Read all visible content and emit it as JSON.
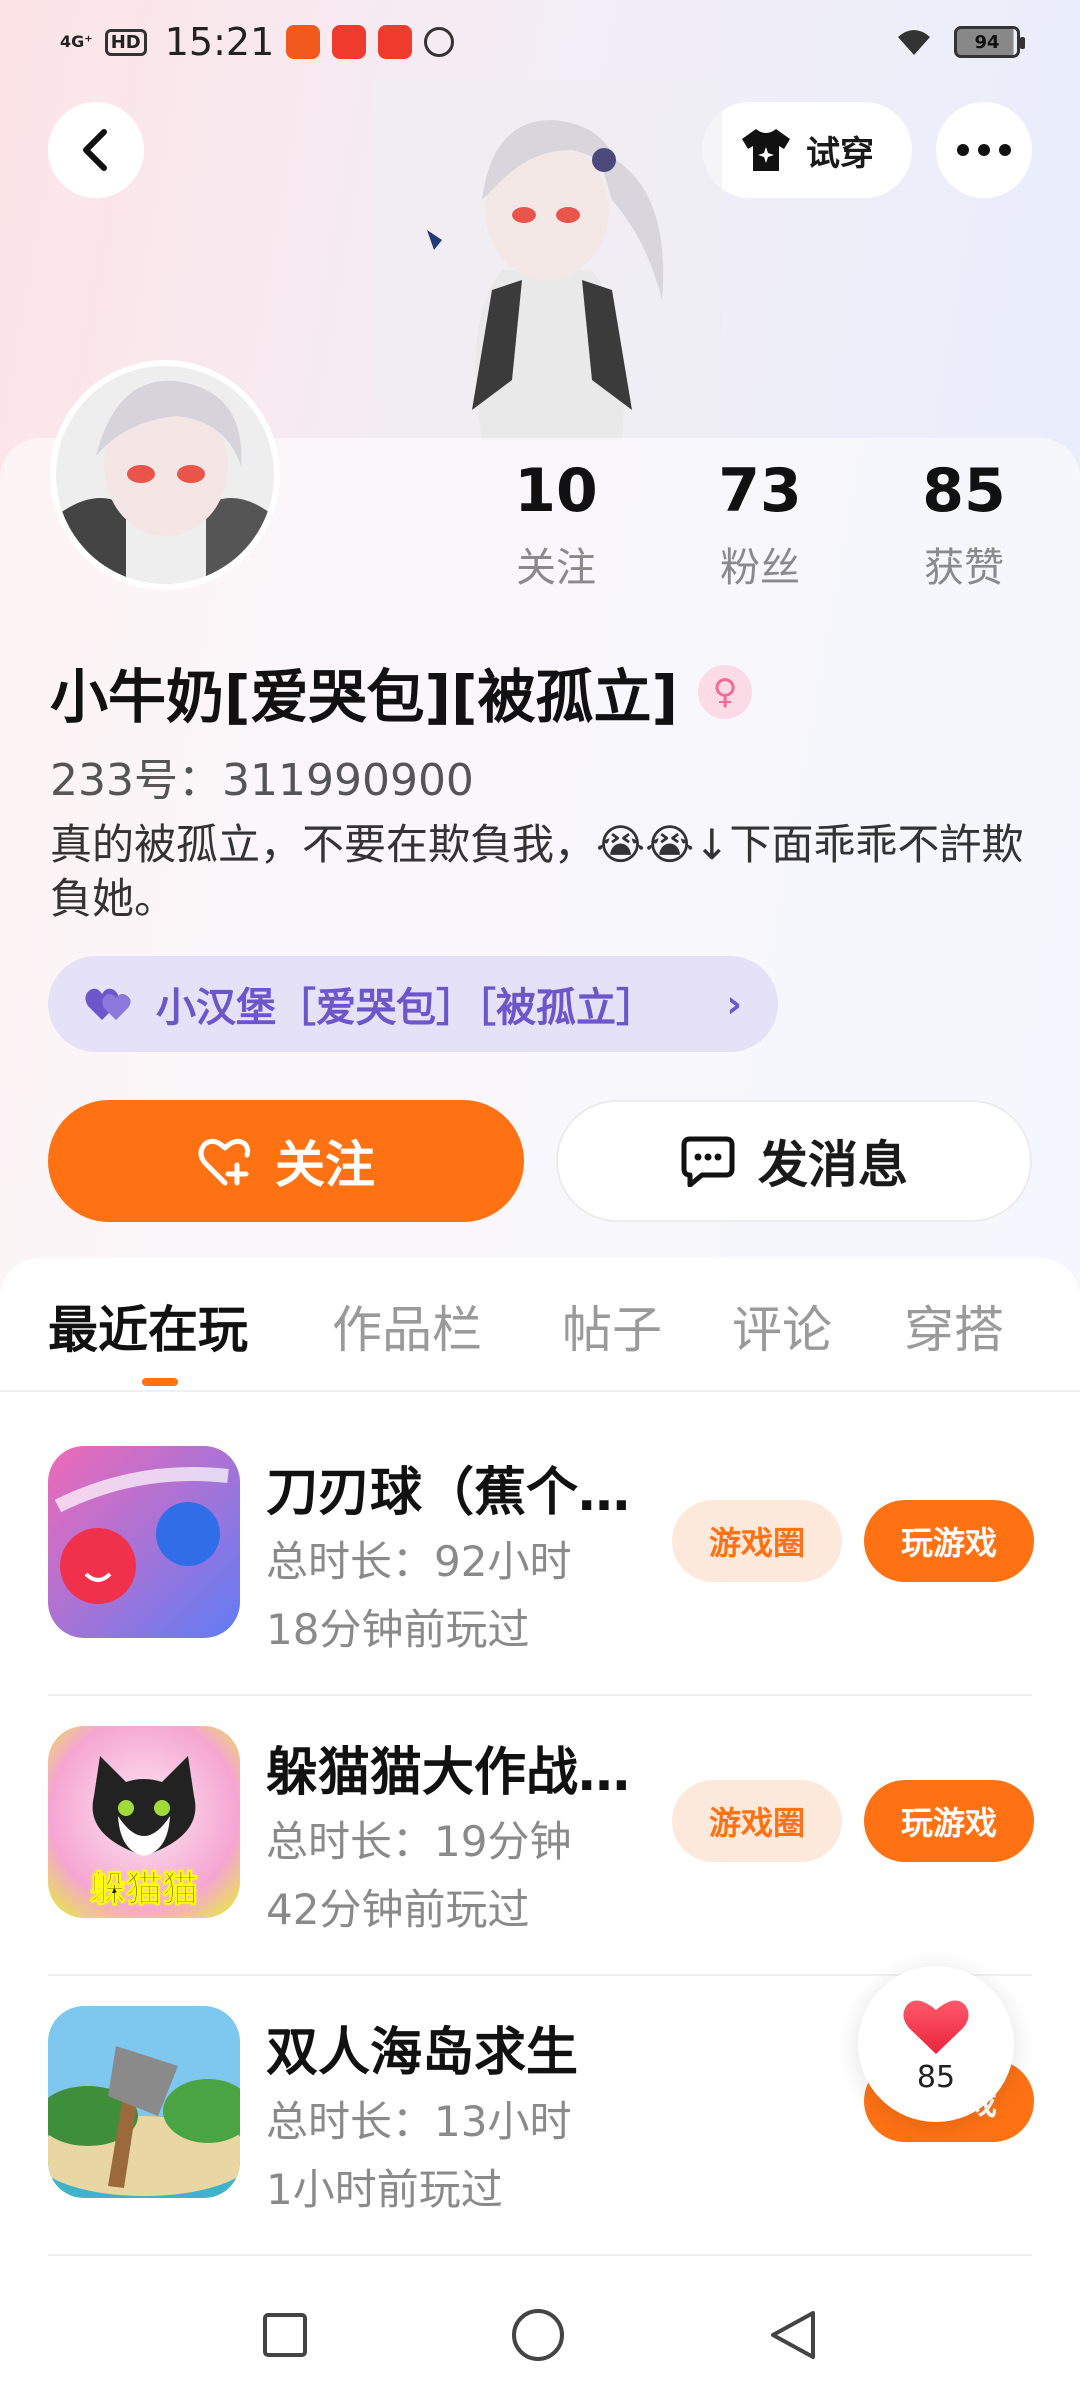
{
  "status_bar": {
    "network": "4G⁺",
    "hd": "HD",
    "time": "15:21",
    "battery": "94"
  },
  "header": {
    "tryon_label": "试穿"
  },
  "profile": {
    "stats": [
      {
        "value": "10",
        "label": "关注"
      },
      {
        "value": "73",
        "label": "粉丝"
      },
      {
        "value": "85",
        "label": "获赞"
      }
    ],
    "name": "小牛奶[爱哭包][被孤立]",
    "gender_symbol": "♀",
    "uid": "233号：311990900",
    "bio": "真的被孤立，不要在欺負我，😭😭↓下面乖乖不許欺負她。",
    "cp_tag": "小汉堡［爱哭包］［被孤立］",
    "follow_label": "关注",
    "message_label": "发消息"
  },
  "tabs": [
    "最近在玩",
    "作品栏",
    "帖子",
    "评论",
    "穿搭"
  ],
  "games": [
    {
      "title": "刀刃球（蕉个…",
      "duration": "总时长：92小时",
      "last_played": "18分钟前玩过",
      "circle_label": "游戏圈",
      "play_label": "玩游戏"
    },
    {
      "title": "躲猫猫大作战…",
      "duration": "总时长：19分钟",
      "last_played": "42分钟前玩过",
      "circle_label": "游戏圈",
      "play_label": "玩游戏",
      "icon_text": "躲猫猫"
    },
    {
      "title": "双人海岛求生",
      "duration": "总时长：13小时",
      "last_played": "1小时前玩过",
      "play_label": "玩游戏"
    }
  ],
  "like_float": {
    "count": "85"
  },
  "colors": {
    "accent": "#ff7214",
    "cp_purple": "#6b57c9"
  }
}
